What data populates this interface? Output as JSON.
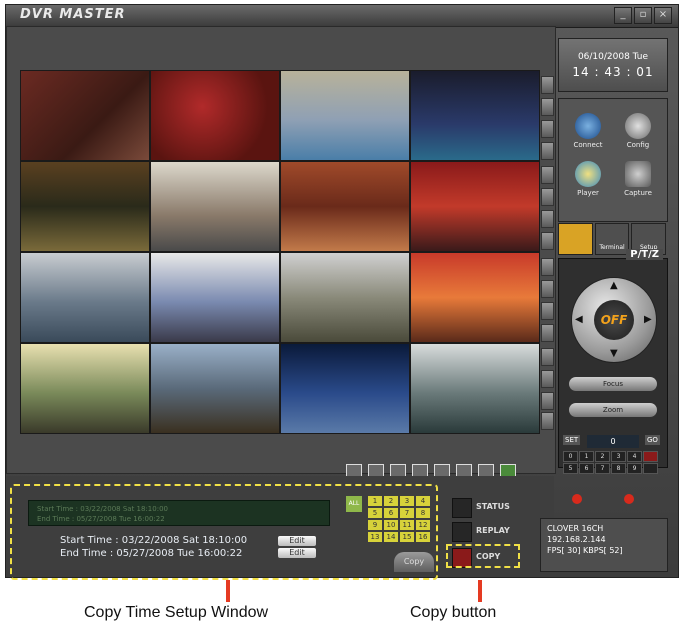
{
  "window": {
    "title": "DVR MASTER",
    "controls": [
      "_",
      "▫",
      "×"
    ]
  },
  "clock": {
    "date": "06/10/2008 Tue",
    "time": "14 : 43 : 01"
  },
  "functions": [
    {
      "label": "Connect",
      "icon": "connect-icon"
    },
    {
      "label": "Config",
      "icon": "config-icon"
    },
    {
      "label": "Player",
      "icon": "player-icon"
    },
    {
      "label": "Capture",
      "icon": "capture-icon"
    }
  ],
  "tabs": [
    "",
    "Terminal",
    "Setup"
  ],
  "ptz": {
    "label": "P/T/Z",
    "center": "OFF",
    "focus_label": "Focus",
    "zoom_label": "Zoom",
    "set_label": "SET",
    "value": "0",
    "go_label": "GO",
    "presets": [
      "0",
      "1",
      "2",
      "3",
      "4",
      "",
      "5",
      "6",
      "7",
      "8",
      "9",
      ""
    ]
  },
  "copy_window": {
    "lcd_line1": "Start Time : 03/22/2008 Sat 18:10:00",
    "lcd_line2": "End  Time : 05/27/2008 Tue 16:00:22",
    "start_time": "Start Time : 03/22/2008 Sat 18:10:00",
    "end_time": "End  Time : 05/27/2008 Tue 16:00:22",
    "edit_label": "Edit",
    "all_label": "ALL",
    "channels": [
      "1",
      "2",
      "3",
      "4",
      "5",
      "6",
      "7",
      "8",
      "9",
      "10",
      "11",
      "12",
      "13",
      "14",
      "15",
      "16"
    ],
    "copy_small_label": "Copy"
  },
  "modes": {
    "status": "STATUS",
    "replay": "REPLAY",
    "copy": "COPY"
  },
  "info": {
    "model": "CLOVER 16CH",
    "ip": "192.168.2.144",
    "stats": "FPS[ 30]  KBPS[ 52]"
  },
  "captions": {
    "left": "Copy Time Setup Window",
    "right": "Copy button"
  },
  "colors": {
    "highlight": "#f0e046",
    "pointer": "#e53a22",
    "ptz_center": "#f3a21b"
  }
}
